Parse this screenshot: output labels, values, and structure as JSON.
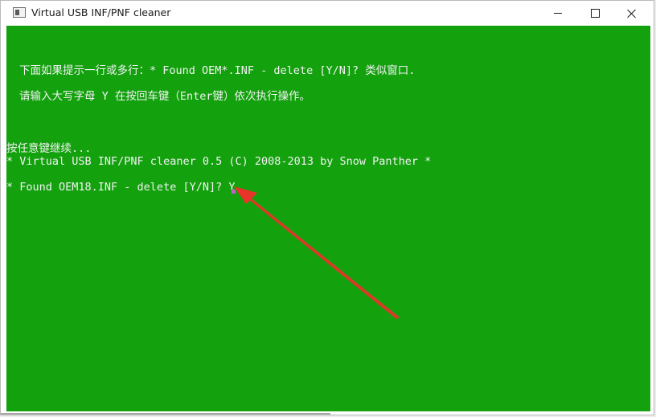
{
  "window": {
    "title": "Virtual USB INF/PNF cleaner"
  },
  "console": {
    "line1": "下面如果提示一行或多行：* Found OEM*.INF - delete [Y/N]? 类似窗口.",
    "line2": "请输入大写字母 Y 在按回车键（Enter键）依次执行操作。",
    "line3": "按任意键继续...",
    "line4": "* Virtual USB INF/PNF cleaner 0.5 (C) 2008-2013 by Snow Panther *",
    "line5": "* Found OEM18.INF - delete [Y/N]? Y"
  },
  "colors": {
    "console_bg": "#13a10e",
    "console_text": "#f2f2f2",
    "annotation_arrow": "#e8342a"
  },
  "icons": {
    "app": "console-window-icon",
    "minimize": "minimize-icon",
    "maximize": "maximize-icon",
    "close": "close-icon",
    "annotation": "red-arrow-annotation"
  }
}
